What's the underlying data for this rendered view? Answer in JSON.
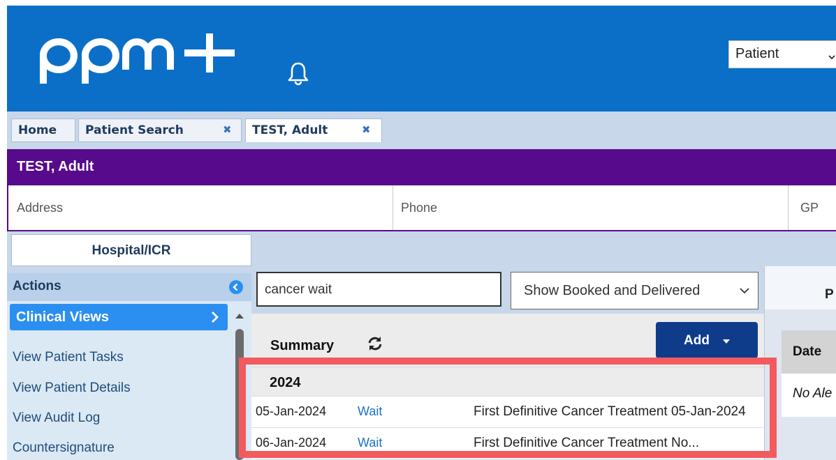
{
  "header": {
    "logo_text": "ppm+",
    "context_select": {
      "value": "Patient"
    }
  },
  "tabs": [
    {
      "label": "Home",
      "closable": false
    },
    {
      "label": "Patient Search",
      "closable": true,
      "close_glyph": "✖"
    },
    {
      "label": "TEST, Adult",
      "closable": true,
      "close_glyph": "✖",
      "active": true
    }
  ],
  "patient": {
    "name": "TEST, Adult",
    "address_label": "Address",
    "phone_label": "Phone",
    "gp_label": "GP"
  },
  "context_tab": {
    "label": "Hospital/ICR"
  },
  "actions": {
    "title": "Actions",
    "active_item": "Clinical Views",
    "items": [
      "View Patient Tasks",
      "View Patient Details",
      "View Audit Log",
      "Countersignature"
    ]
  },
  "search": {
    "value": "cancer wait"
  },
  "filter": {
    "value": "Show Booked and Delivered"
  },
  "summary": {
    "title": "Summary",
    "add_label": "Add",
    "year": "2024",
    "rows": [
      {
        "date": "05-Jan-2024",
        "status": "Wait",
        "description": "First Definitive Cancer Treatment 05-Jan-2024"
      },
      {
        "date": "06-Jan-2024",
        "status": "Wait",
        "description": "First Definitive Cancer Treatment No..."
      }
    ]
  },
  "right_panel": {
    "top_label": "P",
    "date_header": "Date",
    "empty_text": "No Ale"
  },
  "colors": {
    "header_blue": "#0b6fc8",
    "banner_purple": "#570a8c",
    "active_action_blue": "#2a8ff0",
    "add_button_navy": "#0e3c8a",
    "highlight_red": "#f25a5e"
  },
  "icons": [
    "bell-icon",
    "chevron-down-icon",
    "close-icon",
    "collapse-left-icon",
    "chevron-right-icon",
    "refresh-icon",
    "caret-down-icon",
    "scroll-up-icon"
  ]
}
